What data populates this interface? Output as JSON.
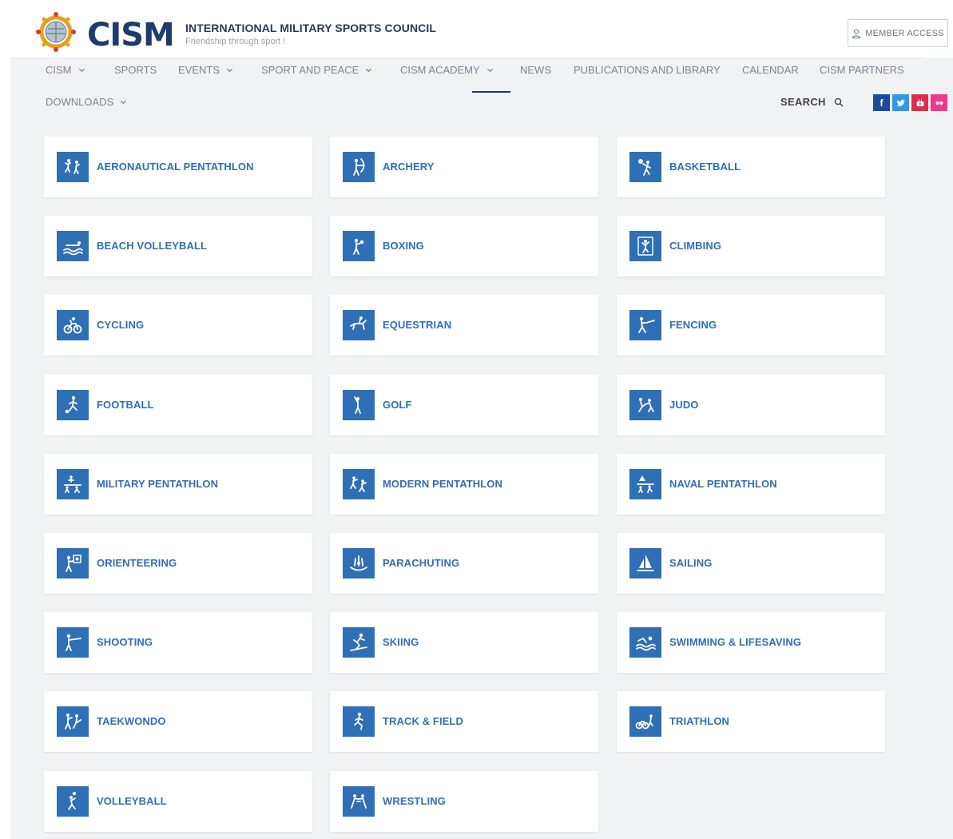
{
  "header": {
    "logo_text": "CISM",
    "org_name": "INTERNATIONAL MILITARY SPORTS COUNCIL",
    "tagline": "Friendship through sport !",
    "member_access": "MEMBER ACCESS"
  },
  "nav": {
    "items": [
      {
        "label": "CISM",
        "dropdown": true
      },
      {
        "label": "SPORTS",
        "dropdown": false
      },
      {
        "label": "EVENTS",
        "dropdown": true
      },
      {
        "label": "SPORT AND PEACE",
        "dropdown": true
      },
      {
        "label": "CISM ACADEMY",
        "dropdown": true
      },
      {
        "label": "NEWS",
        "dropdown": false
      },
      {
        "label": "PUBLICATIONS AND LIBRARY",
        "dropdown": false
      },
      {
        "label": "CALENDAR",
        "dropdown": false
      },
      {
        "label": "CISM PARTNERS",
        "dropdown": false
      }
    ],
    "downloads": "DOWNLOADS",
    "search": "SEARCH"
  },
  "social": {
    "facebook": "f",
    "twitter_icon": "bird-icon",
    "youtube_icon": "play-icon",
    "flickr_icon": "dots-icon"
  },
  "colors": {
    "accent": "#2e6fb5",
    "brand_dark": "#1d3b6e",
    "background": "#f1f2f3"
  },
  "sports": [
    {
      "label": "AERONAUTICAL PENTATHLON",
      "icon": "aeronautical-pentathlon-icon"
    },
    {
      "label": "ARCHERY",
      "icon": "archery-icon"
    },
    {
      "label": "BASKETBALL",
      "icon": "basketball-icon"
    },
    {
      "label": "BEACH VOLLEYBALL",
      "icon": "beach-volleyball-icon"
    },
    {
      "label": "BOXING",
      "icon": "boxing-icon"
    },
    {
      "label": "CLIMBING",
      "icon": "climbing-icon"
    },
    {
      "label": "CYCLING",
      "icon": "cycling-icon"
    },
    {
      "label": "EQUESTRIAN",
      "icon": "equestrian-icon"
    },
    {
      "label": "FENCING",
      "icon": "fencing-icon"
    },
    {
      "label": "FOOTBALL",
      "icon": "football-icon"
    },
    {
      "label": "GOLF",
      "icon": "golf-icon"
    },
    {
      "label": "JUDO",
      "icon": "judo-icon"
    },
    {
      "label": "MILITARY PENTATHLON",
      "icon": "military-pentathlon-icon"
    },
    {
      "label": "MODERN PENTATHLON",
      "icon": "modern-pentathlon-icon"
    },
    {
      "label": "NAVAL PENTATHLON",
      "icon": "naval-pentathlon-icon"
    },
    {
      "label": "ORIENTEERING",
      "icon": "orienteering-icon"
    },
    {
      "label": "PARACHUTING",
      "icon": "parachuting-icon"
    },
    {
      "label": "SAILING",
      "icon": "sailing-icon"
    },
    {
      "label": "SHOOTING",
      "icon": "shooting-icon"
    },
    {
      "label": "SKIING",
      "icon": "skiing-icon"
    },
    {
      "label": "SWIMMING & LIFESAVING",
      "icon": "swimming-icon"
    },
    {
      "label": "TAEKWONDO",
      "icon": "taekwondo-icon"
    },
    {
      "label": "TRACK & FIELD",
      "icon": "track-and-field-icon"
    },
    {
      "label": "TRIATHLON",
      "icon": "triathlon-icon"
    },
    {
      "label": "VOLLEYBALL",
      "icon": "volleyball-icon"
    },
    {
      "label": "WRESTLING",
      "icon": "wrestling-icon"
    }
  ]
}
